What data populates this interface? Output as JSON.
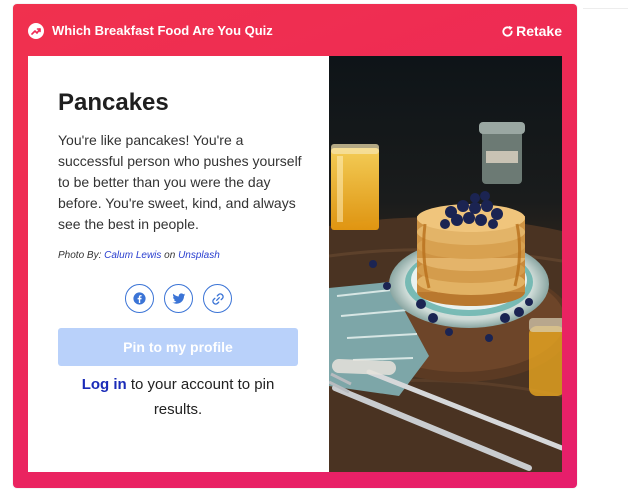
{
  "header": {
    "quiz_title": "Which Breakfast Food Are You Quiz",
    "retake_label": "Retake"
  },
  "result": {
    "title": "Pancakes",
    "description": "You're like pancakes! You're a successful person who pushes yourself to be better than you were the day before. You're sweet, kind, and always see the best in people.",
    "credit": {
      "prefix": "Photo By: ",
      "author": "Calum Lewis",
      "middle": " on ",
      "source": "Unsplash"
    }
  },
  "share": {
    "icons": [
      "facebook-icon",
      "twitter-icon",
      "link-icon"
    ]
  },
  "pin": {
    "label": "Pin to my profile"
  },
  "login": {
    "link_label": "Log in",
    "suffix": " to your account to pin results."
  },
  "colors": {
    "gradient_top": "#f0314e",
    "gradient_bottom": "#e61e6c",
    "accent_blue": "#3b74d6",
    "pin_disabled": "#b9d1fa",
    "link": "#1a2bb8"
  }
}
